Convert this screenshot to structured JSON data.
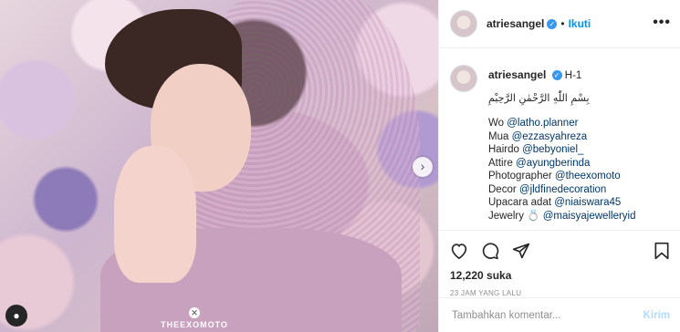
{
  "photo": {
    "watermark": "THEEXOMOTO",
    "watermark_icon": "x-icon"
  },
  "header": {
    "username": "atriesangel",
    "separator": "•",
    "follow_label": "Ikuti",
    "more_icon": "more-options-icon"
  },
  "caption": {
    "username": "atriesangel",
    "first_line": "H-1",
    "arabic": "بِسْمِ اللّٰهِ الرَّحْمٰنِ الرَّحِيْمِ",
    "credits": [
      {
        "label": "Wo",
        "handle": "@latho.planner"
      },
      {
        "label": "Mua",
        "handle": "@ezzasyahreza"
      },
      {
        "label": "Hairdo",
        "handle": "@bebyoniel_"
      },
      {
        "label": "Attire",
        "handle": "@ayungberinda"
      },
      {
        "label": "Photographer",
        "handle": "@theexomoto"
      },
      {
        "label": "Decor",
        "handle": "@jldfinedecoration"
      },
      {
        "label": "Upacara adat",
        "handle": "@niaiswara45"
      },
      {
        "label": "Jewelry 💍",
        "handle": "@maisyajewelleryid"
      }
    ]
  },
  "stats": {
    "likes": "12,220 suka",
    "time": "23 JAM YANG LALU"
  },
  "comment": {
    "placeholder": "Tambahkan komentar...",
    "send_label": "Kirim"
  }
}
